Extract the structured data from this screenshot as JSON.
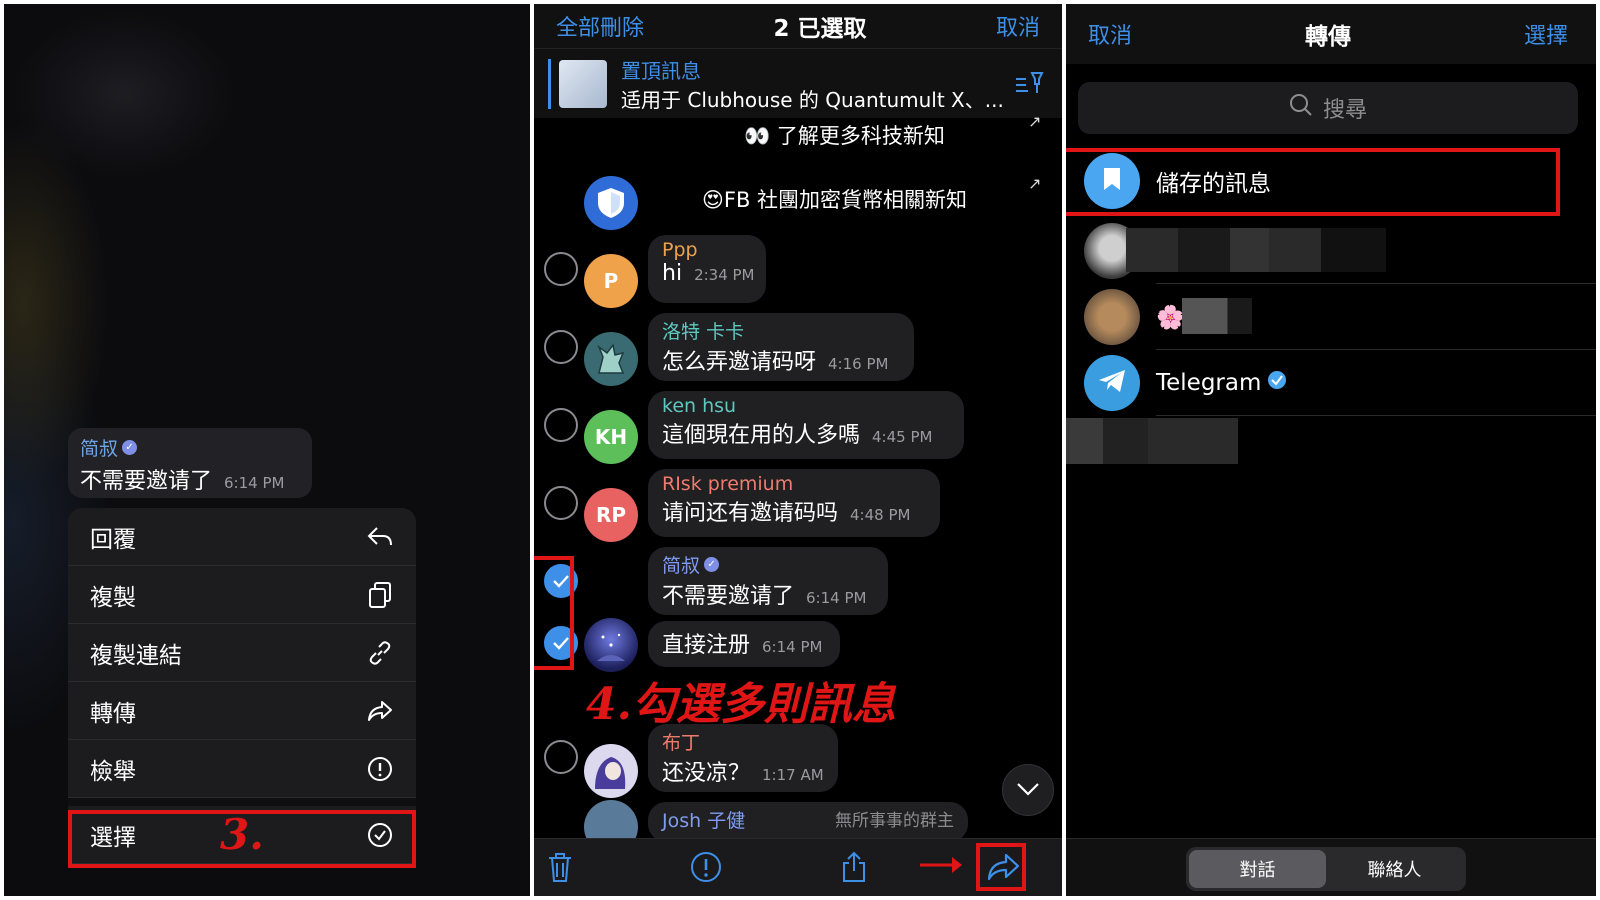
{
  "panel1": {
    "message": {
      "sender": "简叔",
      "text": "不需要邀请了",
      "time": "6:14 PM"
    },
    "menu": [
      {
        "label": "回覆",
        "icon": "reply-icon"
      },
      {
        "label": "複製",
        "icon": "copy-icon"
      },
      {
        "label": "複製連結",
        "icon": "link-icon"
      },
      {
        "label": "轉傳",
        "icon": "forward-icon"
      },
      {
        "label": "檢舉",
        "icon": "report-icon"
      },
      {
        "label": "選擇",
        "icon": "select-check-icon"
      }
    ],
    "step_label": "3."
  },
  "panel2": {
    "header": {
      "delete_all": "全部刪除",
      "title": "2 已選取",
      "cancel": "取消"
    },
    "pinned": {
      "title": "置頂訊息",
      "text": "适用于 Clubhouse 的 Quantumult X、..."
    },
    "line1": "👀 了解更多科技新知",
    "line2": "😍FB 社團加密貨幣相關新知",
    "messages": [
      {
        "name": "Ppp",
        "text": "hi",
        "time": "2:34 PM",
        "avatar_text": "P",
        "avatar_color": "#f0a24a",
        "name_color": "#f0a24a",
        "checked": false
      },
      {
        "name": "洛特 卡卡",
        "text": "怎么弄邀请码呀",
        "time": "4:16 PM",
        "avatar_text": "",
        "avatar_color": "#3b6b72",
        "name_color": "#5fc8c0",
        "checked": false
      },
      {
        "name": "ken hsu",
        "text": "這個現在用的人多嗎",
        "time": "4:45 PM",
        "avatar_text": "KH",
        "avatar_color": "#5dbf5a",
        "name_color": "#5fc8c0",
        "checked": false
      },
      {
        "name": "RIsk premium",
        "text": "请问还有邀请码吗",
        "time": "4:48 PM",
        "avatar_text": "RP",
        "avatar_color": "#e86262",
        "name_color": "#ef7b6e",
        "checked": false
      },
      {
        "name": "简叔",
        "text": "不需要邀请了",
        "time": "6:14 PM",
        "avatar_text": "",
        "avatar_color": "",
        "name_color": "#7f9cf0",
        "checked": true
      },
      {
        "name": "",
        "text": "直接注册",
        "time": "6:14 PM",
        "avatar_text": "",
        "avatar_color": "#2b3a8a",
        "name_color": "",
        "checked": true
      },
      {
        "name": "布丁",
        "text": "还没凉？",
        "time": "1:17 AM",
        "avatar_text": "",
        "avatar_color": "#5a4aa0",
        "name_color": "#ef7b6e",
        "checked": false
      },
      {
        "name": "Josh 子健",
        "text": "無所事事的群主",
        "time": "",
        "avatar_text": "",
        "avatar_color": "#5a7a9a",
        "name_color": "#7f9cf0",
        "checked": false
      }
    ],
    "step_label": "4.勾選多則訊息",
    "bottom_icons": [
      "trash-icon",
      "info-icon",
      "share-icon",
      "forward-icon"
    ]
  },
  "panel3": {
    "header": {
      "cancel": "取消",
      "title": "轉傳",
      "select": "選擇"
    },
    "search_placeholder": "搜尋",
    "contacts": [
      {
        "name": "儲存的訊息",
        "type": "saved"
      },
      {
        "name": "",
        "type": "blurred"
      },
      {
        "name": "🌸",
        "type": "blurred-short"
      },
      {
        "name": "Telegram",
        "type": "telegram",
        "verified": true
      }
    ],
    "segments": [
      {
        "label": "對話",
        "active": true
      },
      {
        "label": "聯絡人",
        "active": false
      }
    ]
  },
  "colors": {
    "accent": "#3d8fe8",
    "highlight": "#e01616",
    "bubble": "#202022"
  }
}
